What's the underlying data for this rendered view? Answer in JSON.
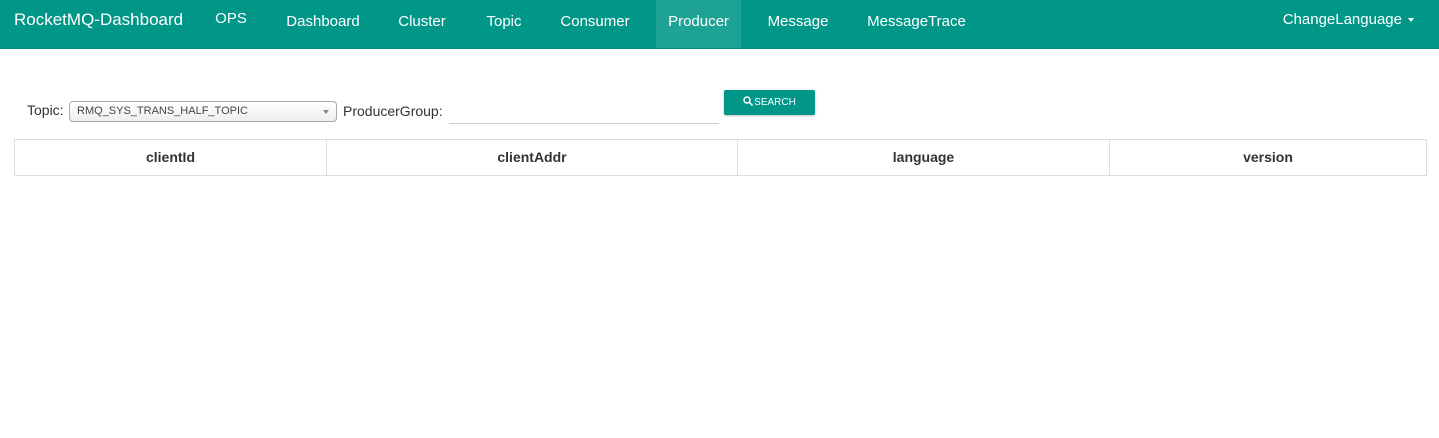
{
  "navbar": {
    "brand": "RocketMQ-Dashboard",
    "items": [
      {
        "label": "OPS"
      },
      {
        "label": "Dashboard"
      },
      {
        "label": "Cluster"
      },
      {
        "label": "Topic"
      },
      {
        "label": "Consumer"
      },
      {
        "label": "Producer",
        "active": true
      },
      {
        "label": "Message"
      },
      {
        "label": "MessageTrace"
      }
    ],
    "language_menu": "ChangeLanguage",
    "color": "#009688"
  },
  "filters": {
    "topic_label": "Topic:",
    "topic_value": "RMQ_SYS_TRANS_HALF_TOPIC",
    "producer_group_label": "ProducerGroup:",
    "producer_group_value": "",
    "search_label": "SEARCH",
    "search_icon": "search-icon"
  },
  "table": {
    "columns": [
      "clientId",
      "clientAddr",
      "language",
      "version"
    ],
    "rows": []
  }
}
